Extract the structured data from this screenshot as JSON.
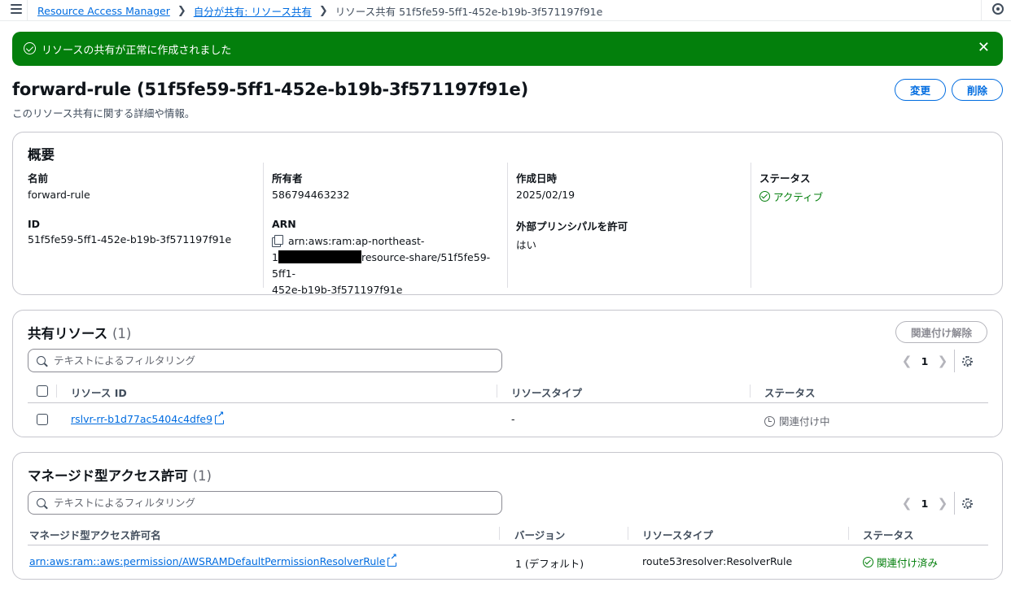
{
  "breadcrumb": {
    "items": [
      "Resource Access Manager",
      "自分が共有: リソース共有"
    ],
    "current": "リソース共有 51f5fe59-5ff1-452e-b19b-3f571197f91e"
  },
  "flash": {
    "message": "リソースの共有が正常に作成されました",
    "close": "✕"
  },
  "header": {
    "title": "forward-rule (51f5fe59-5ff1-452e-b19b-3f571197f91e)",
    "subtitle": "このリソース共有に関する詳細や情報。",
    "edit": "変更",
    "delete": "削除"
  },
  "overview": {
    "title": "概要",
    "name_label": "名前",
    "name_value": "forward-rule",
    "id_label": "ID",
    "id_value": "51f5fe59-5ff1-452e-b19b-3f571197f91e",
    "owner_label": "所有者",
    "owner_value": "586794463232",
    "arn_label": "ARN",
    "arn_line1": "arn:aws:ram:ap-northeast-",
    "arn_line2_prefix": "1",
    "arn_line2_suffix": "resource-share/51f5fe59-5ff1-",
    "arn_line3": "452e-b19b-3f571197f91e",
    "created_label": "作成日時",
    "created_value": "2025/02/19",
    "external_label": "外部プリンシパルを許可",
    "external_value": "はい",
    "status_label": "ステータス",
    "status_value": "アクティブ"
  },
  "shared": {
    "title": "共有リソース",
    "count": "(1)",
    "disassociate": "関連付け解除",
    "filter_placeholder": "テキストによるフィルタリング",
    "page": "1",
    "columns": [
      "リソース ID",
      "リソースタイプ",
      "ステータス"
    ],
    "rows": [
      {
        "id": "rslvr-rr-b1d77ac5404c4dfe9",
        "type": "-",
        "status": "関連付け中"
      }
    ]
  },
  "managed": {
    "title": "マネージド型アクセス許可",
    "count": "(1)",
    "filter_placeholder": "テキストによるフィルタリング",
    "page": "1",
    "columns": [
      "マネージド型アクセス許可名",
      "バージョン",
      "リソースタイプ",
      "ステータス"
    ],
    "rows": [
      {
        "name": "arn:aws:ram::aws:permission/AWSRAMDefaultPermissionResolverRule",
        "version": "1 (デフォルト)",
        "type": "route53resolver:ResolverRule",
        "status": "関連付け済み"
      }
    ]
  },
  "colors": {
    "success": "#037f0c",
    "link": "#006ce0",
    "text": "#0f141a"
  },
  "icons": [
    "menu-icon",
    "chevron-right-icon",
    "settings-icon",
    "success-icon",
    "close-icon",
    "copy-icon",
    "search-icon",
    "external-link-icon",
    "clock-icon",
    "gear-icon"
  ]
}
